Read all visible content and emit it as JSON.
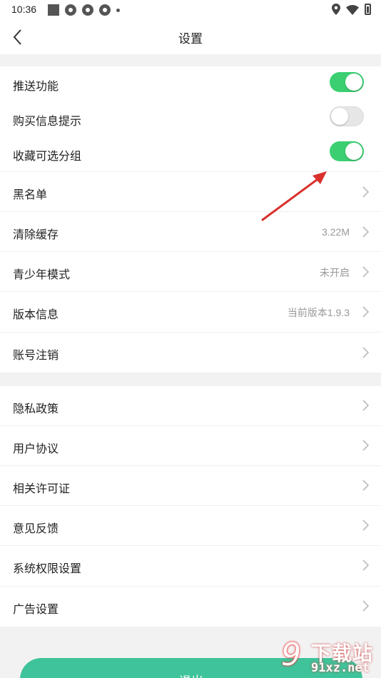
{
  "status_bar": {
    "time": "10:36",
    "icons_left": [
      "stop-square-icon",
      "app-notification-icon",
      "app-notification-icon",
      "app-notification-icon",
      "more-dot-icon"
    ],
    "icons_right": [
      "location-icon",
      "wifi-icon",
      "battery-charging-icon"
    ]
  },
  "header": {
    "back_icon": "back-chevron-icon",
    "title": "设置"
  },
  "toggles": [
    {
      "label": "推送功能",
      "on": true
    },
    {
      "label": "购买信息提示",
      "on": false
    },
    {
      "label": "收藏可选分组",
      "on": true
    }
  ],
  "group1": [
    {
      "label": "黑名单",
      "value": ""
    },
    {
      "label": "清除缓存",
      "value": "3.22M"
    },
    {
      "label": "青少年模式",
      "value": "未开启"
    },
    {
      "label": "版本信息",
      "value": "当前版本1.9.3"
    },
    {
      "label": "账号注销",
      "value": ""
    }
  ],
  "group2": [
    {
      "label": "隐私政策"
    },
    {
      "label": "用户协议"
    },
    {
      "label": "相关许可证"
    },
    {
      "label": "意见反馈"
    },
    {
      "label": "系统权限设置"
    },
    {
      "label": "广告设置"
    }
  ],
  "logout_label": "退出",
  "watermark": {
    "logo": "9",
    "text": "下载站",
    "url": "91xz.net"
  },
  "colors": {
    "accent_green": "#3ccf72",
    "logout_green": "#3fc39a",
    "annotation_arrow": "#d9302c"
  }
}
